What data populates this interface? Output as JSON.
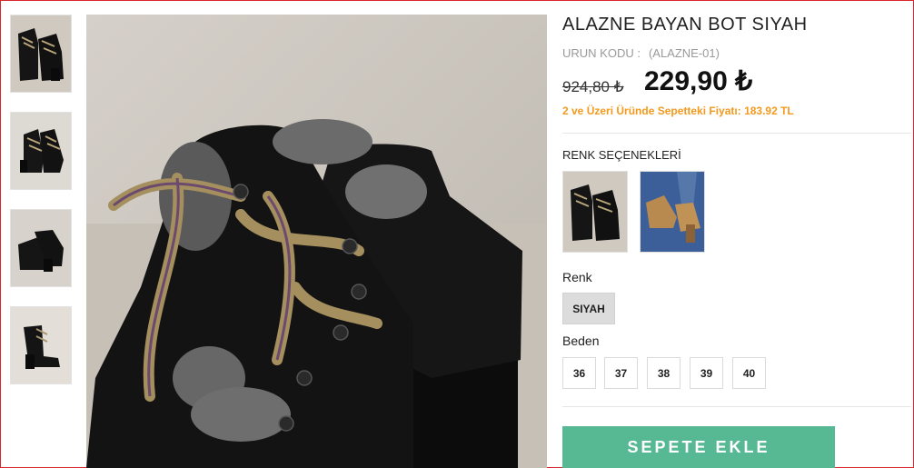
{
  "product": {
    "title": "ALAZNE BAYAN BOT SIYAH",
    "code_label": "URUN KODU :",
    "code_value": "(ALAZNE-01)",
    "old_price": "924,80 ₺",
    "price": "229,90 ₺",
    "promo": "2 ve Üzeri Üründe Sepetteki Fiyatı: 183.92 TL"
  },
  "color_options": {
    "label": "RENK SEÇENEKLERİ"
  },
  "color": {
    "label": "Renk",
    "selected": "SIYAH"
  },
  "size": {
    "label": "Beden",
    "options": [
      "36",
      "37",
      "38",
      "39",
      "40"
    ]
  },
  "cart": {
    "button_label": "SEPETE EKLE"
  },
  "colors": {
    "accent_orange": "#f39a1f",
    "button_green": "#57b894",
    "frame_red": "#d8262c"
  }
}
